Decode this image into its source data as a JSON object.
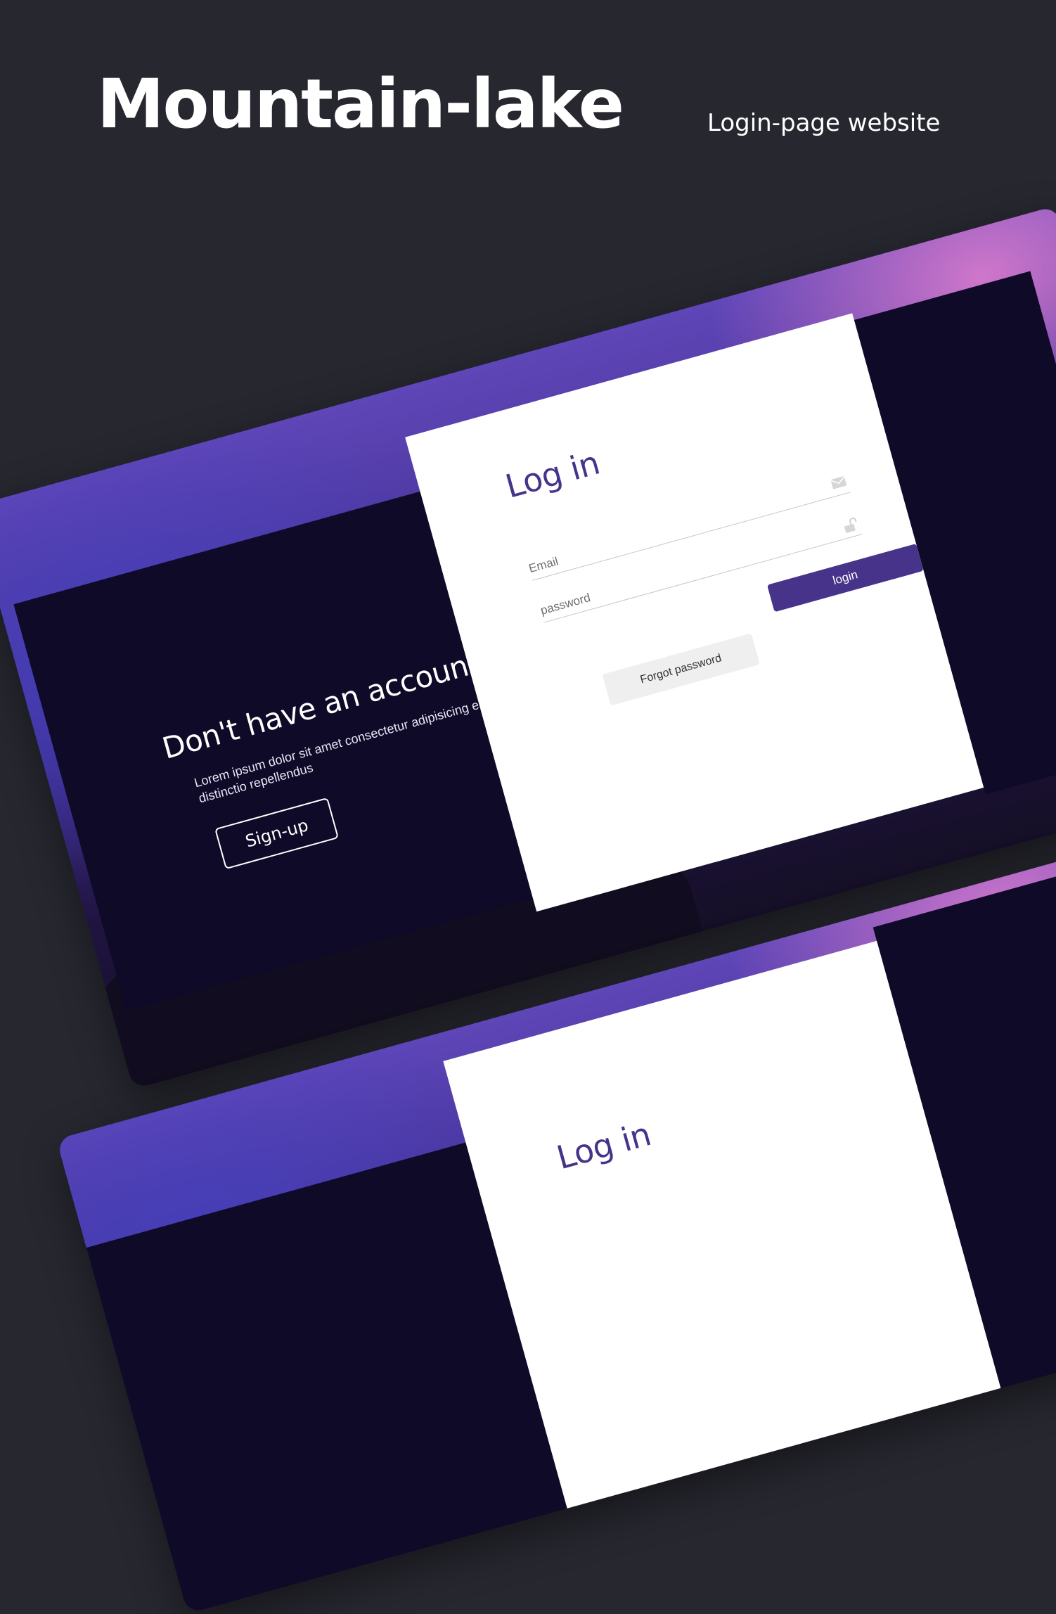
{
  "header": {
    "title": "Mountain-lake",
    "subtitle": "Login-page website"
  },
  "mockup_primary": {
    "cta": {
      "title": "Don't have an account ?",
      "description": "Lorem ipsum dolor sit amet consectetur adipisicing elit. Architecto distinctio repellendus",
      "signup_label": "Sign-up"
    },
    "login": {
      "title": "Log in",
      "email_placeholder": "Email",
      "password_placeholder": "password",
      "login_label": "login",
      "forgot_label": "Forgot password"
    },
    "icons": {
      "email": "envelope-icon",
      "password": "unlock-icon"
    }
  },
  "mockup_secondary": {
    "login_title": "Log in"
  },
  "colors": {
    "background": "#272730",
    "accent": "#47338a",
    "dark_panel": "#0e0a28",
    "card": "#ffffff",
    "forgot_bg": "#efefef"
  }
}
